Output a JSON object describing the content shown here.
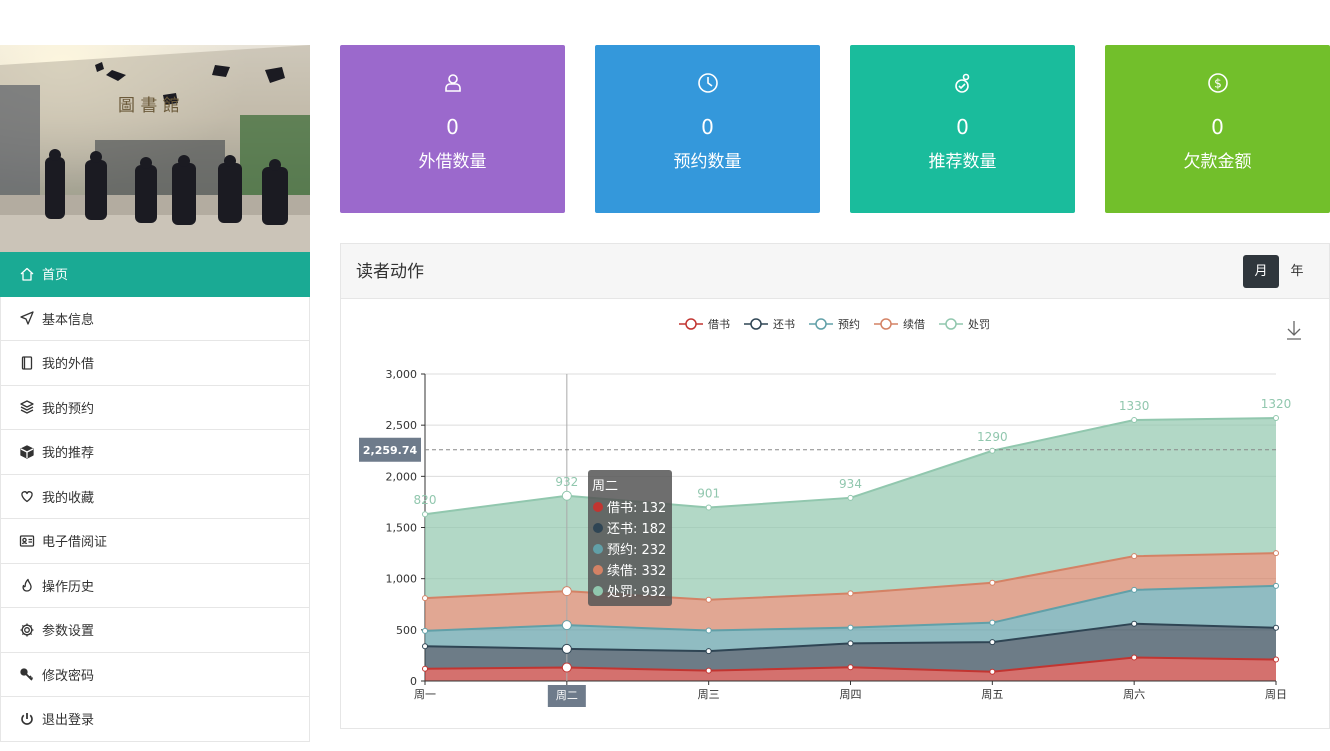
{
  "sidebar": {
    "banner_sign": "圖 書 館",
    "items": [
      {
        "label": "首页",
        "icon": "home-icon"
      },
      {
        "label": "基本信息",
        "icon": "send-icon"
      },
      {
        "label": "我的外借",
        "icon": "book-icon"
      },
      {
        "label": "我的预约",
        "icon": "layers-icon"
      },
      {
        "label": "我的推荐",
        "icon": "cube-icon"
      },
      {
        "label": "我的收藏",
        "icon": "heart-icon"
      },
      {
        "label": "电子借阅证",
        "icon": "id-card-icon"
      },
      {
        "label": "操作历史",
        "icon": "fire-icon"
      },
      {
        "label": "参数设置",
        "icon": "gear-icon"
      },
      {
        "label": "修改密码",
        "icon": "key-icon"
      },
      {
        "label": "退出登录",
        "icon": "power-icon"
      }
    ],
    "active_index": 0
  },
  "cards": [
    {
      "value": "0",
      "label": "外借数量",
      "color": "#9b69cc",
      "icon": "user-icon"
    },
    {
      "value": "0",
      "label": "预约数量",
      "color": "#3498db",
      "icon": "clock-icon"
    },
    {
      "value": "0",
      "label": "推荐数量",
      "color": "#1abc9c",
      "icon": "recommend-icon"
    },
    {
      "value": "0",
      "label": "欠款金额",
      "color": "#72bf2b",
      "icon": "money-icon"
    }
  ],
  "panel": {
    "title": "读者动作",
    "toggle": {
      "month": "月",
      "year": "年",
      "selected": "月"
    }
  },
  "chart_data": {
    "type": "area",
    "stacked": true,
    "categories": [
      "周一",
      "周二",
      "周三",
      "周四",
      "周五",
      "周六",
      "周日"
    ],
    "series": [
      {
        "name": "借书",
        "color": "#c23531",
        "values": [
          120,
          132,
          101,
          134,
          90,
          230,
          210
        ]
      },
      {
        "name": "还书",
        "color": "#2f4554",
        "values": [
          220,
          182,
          191,
          234,
          290,
          330,
          310
        ]
      },
      {
        "name": "预约",
        "color": "#61a0a8",
        "values": [
          150,
          232,
          201,
          154,
          190,
          330,
          410
        ]
      },
      {
        "name": "续借",
        "color": "#d48265",
        "values": [
          320,
          332,
          301,
          334,
          390,
          330,
          320
        ]
      },
      {
        "name": "处罚",
        "color": "#91c7ae",
        "values": [
          820,
          932,
          901,
          934,
          1290,
          1330,
          1320
        ]
      }
    ],
    "top_labels": [
      "820",
      "932",
      "901",
      "934",
      "1290",
      "1330",
      "1320"
    ],
    "y_ticks": [
      "0",
      "500",
      "1,000",
      "1,500",
      "2,000",
      "2,500",
      "3,000"
    ],
    "ylim": [
      0,
      3000
    ],
    "legend": "top-center",
    "grid": true,
    "crosshair": {
      "x_label": "周二",
      "y_label": "2,259.74",
      "y_value": 2259.74
    },
    "tooltip": {
      "title": "周二",
      "lines": [
        "借书: 132",
        "还书: 182",
        "预约: 232",
        "续借: 332",
        "处罚: 932"
      ]
    }
  }
}
